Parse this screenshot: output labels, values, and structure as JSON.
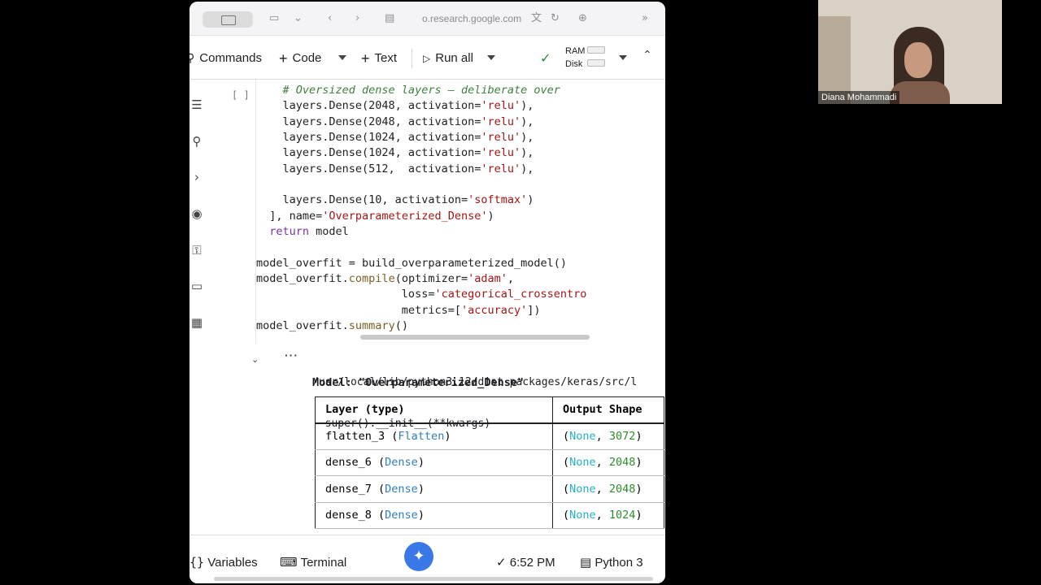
{
  "browser": {
    "url": "o.research.google.com"
  },
  "toolbar": {
    "commands_label": "Commands",
    "code_label": "Code",
    "text_label": "Text",
    "run_all_label": "Run all",
    "ram_label": "RAM",
    "disk_label": "Disk"
  },
  "cell": {
    "execution_count": "[ ]",
    "code_lines": [
      "    # Oversized dense layers — deliberate over",
      "    layers.Dense(2048, activation='relu'),",
      "    layers.Dense(2048, activation='relu'),",
      "    layers.Dense(1024, activation='relu'),",
      "    layers.Dense(1024, activation='relu'),",
      "    layers.Dense(512,  activation='relu'),",
      "",
      "    layers.Dense(10, activation='softmax')",
      "  ], name='Overparameterized_Dense')",
      "  return model",
      "",
      "model_overfit = build_overparameterized_model()",
      "model_overfit.compile(optimizer='adam',",
      "                      loss='categorical_crossentro",
      "                      metrics=['accuracy'])",
      "model_overfit.summary()"
    ]
  },
  "output": {
    "warning_line1": "/usr/local/lib/python3.12/dist-packages/keras/src/l",
    "warning_line2": "  super().__init__(**kwargs)",
    "model_title": "Model: \"Overparameterized_Dense\"",
    "table_headers": [
      "Layer (type)",
      "Output Shape"
    ],
    "rows": [
      {
        "name": "flatten_3",
        "type": "Flatten",
        "none": "None",
        "dim": "3072"
      },
      {
        "name": "dense_6",
        "type": "Dense",
        "none": "None",
        "dim": "2048"
      },
      {
        "name": "dense_7",
        "type": "Dense",
        "none": "None",
        "dim": "2048"
      },
      {
        "name": "dense_8",
        "type": "Dense",
        "none": "None",
        "dim": "1024"
      }
    ]
  },
  "status": {
    "variables_label": "Variables",
    "terminal_label": "Terminal",
    "time": "6:52 PM",
    "runtime": "Python 3"
  },
  "webcam": {
    "participant_name": "Diana Mohammadi"
  },
  "colors": {
    "code_string": "#a31515",
    "code_keyword": "#7b30a8",
    "layer_type": "#2f7fc0",
    "none_value": "#26b3c6",
    "dim_value": "#2e8b2e",
    "check_green": "#1e8e3e",
    "gemini_blue": "#3b78e7"
  }
}
